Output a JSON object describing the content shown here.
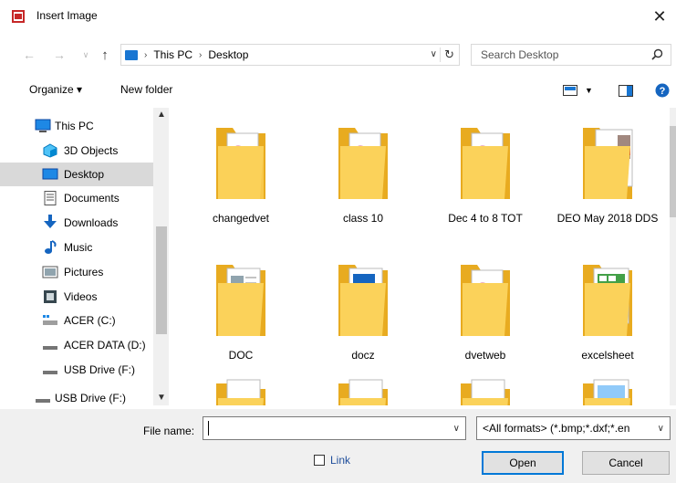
{
  "window": {
    "title": "Insert Image",
    "close_glyph": "✕"
  },
  "nav": {
    "back": "←",
    "forward": "→",
    "recent": "∨",
    "up": "↑"
  },
  "address": {
    "crumbs": [
      "This PC",
      "Desktop"
    ],
    "separator": "›"
  },
  "search": {
    "placeholder": "Search Desktop"
  },
  "toolbar": {
    "organize_label": "Organize ▾",
    "new_folder_label": "New folder"
  },
  "sidebar": {
    "items": [
      {
        "label": "This PC",
        "icon": "pc-icon"
      },
      {
        "label": "3D Objects",
        "icon": "3d-objects-icon"
      },
      {
        "label": "Desktop",
        "icon": "desktop-icon",
        "selected": true
      },
      {
        "label": "Documents",
        "icon": "documents-icon"
      },
      {
        "label": "Downloads",
        "icon": "downloads-icon"
      },
      {
        "label": "Music",
        "icon": "music-icon"
      },
      {
        "label": "Pictures",
        "icon": "pictures-icon"
      },
      {
        "label": "Videos",
        "icon": "videos-icon"
      },
      {
        "label": "ACER (C:)",
        "icon": "drive-c-icon"
      },
      {
        "label": "ACER DATA (D:)",
        "icon": "drive-icon"
      },
      {
        "label": "USB Drive (F:)",
        "icon": "usb-drive-icon"
      },
      {
        "label": "USB Drive (F:)",
        "icon": "usb-drive-icon"
      }
    ]
  },
  "files": [
    {
      "name": "changedvet",
      "thumb": "pdf"
    },
    {
      "name": "class 10",
      "thumb": "pdf"
    },
    {
      "name": "Dec 4 to 8 TOT",
      "thumb": "pdf"
    },
    {
      "name": "DEO May 2018 DDS",
      "thumb": "docs"
    },
    {
      "name": "DOC",
      "thumb": "doc"
    },
    {
      "name": "docz",
      "thumb": "doc"
    },
    {
      "name": "dvetweb",
      "thumb": "pdf"
    },
    {
      "name": "excelsheet",
      "thumb": "excel"
    },
    {
      "name": "",
      "thumb": "doc"
    },
    {
      "name": "",
      "thumb": "doc"
    },
    {
      "name": "",
      "thumb": "doc"
    },
    {
      "name": "",
      "thumb": "doc"
    }
  ],
  "footer": {
    "file_name_label": "File name:",
    "file_name_value": "",
    "filter_value": "<All formats> (*.bmp;*.dxf;*.en",
    "link_label": "Link",
    "open_label": "Open",
    "cancel_label": "Cancel"
  },
  "colors": {
    "accent": "#0078d7",
    "folder": "#f8c84a",
    "folder_dark": "#e8ab20",
    "selection": "#d9d9d9"
  }
}
